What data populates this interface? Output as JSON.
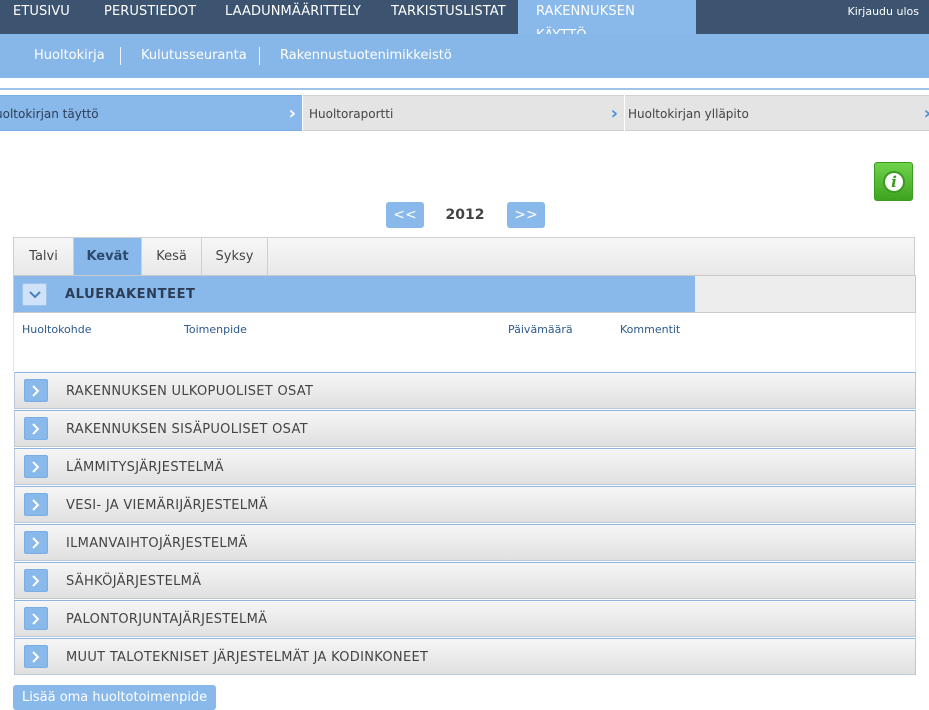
{
  "topnav": {
    "items": [
      "ETUSIVU",
      "PERUSTIEDOT",
      "LAADUNMÄÄRITTELY",
      "TARKISTUSLISTAT",
      "RAKENNUKSEN KÄYTTÖ"
    ],
    "logout": "Kirjaudu ulos",
    "active": "RAKENNUKSEN KÄYTTÖ"
  },
  "subnav": {
    "items": [
      "Huoltokirja",
      "Kulutusseuranta",
      "Rakennustuotenimikkeistö"
    ]
  },
  "steps": {
    "items": [
      "Huoltokirjan täyttö",
      "Huoltoraportti",
      "Huoltokirjan ylläpito"
    ],
    "active": "Huoltokirjan täyttö",
    "chevron": "›"
  },
  "info_icon": "i",
  "year_nav": {
    "prev": "<<",
    "year": "2012",
    "next": ">>"
  },
  "season_tabs": {
    "items": [
      "Talvi",
      "Kevät",
      "Kesä",
      "Syksy"
    ],
    "active": "Kevät"
  },
  "open_section": {
    "title": "ALUERAKENTEET",
    "toggle_icon": "chevron-down-icon",
    "columns": [
      "Huoltokohde",
      "Toimenpide",
      "Päivämäärä",
      "Kommentit"
    ]
  },
  "sections": [
    "RAKENNUKSEN ULKOPUOLISET OSAT",
    "RAKENNUKSEN SISÄPUOLISET OSAT",
    "LÄMMITYSJÄRJESTELMÄ",
    "VESI- JA VIEMÄRIJÄRJESTELMÄ",
    "ILMANVAIHTOJÄRJESTELMÄ",
    "SÄHKÖJÄRJESTELMÄ",
    "PALONTORJUNTAJÄRJESTELMÄ",
    "MUUT TALOTEKNISET JÄRJESTELMÄT JA KODINKONEET"
  ],
  "add_button": "Lisää oma huoltotoimenpide",
  "colors": {
    "nav_dark": "#3c5470",
    "accent_blue": "#89b8ea",
    "info_green": "#4cb82b"
  }
}
